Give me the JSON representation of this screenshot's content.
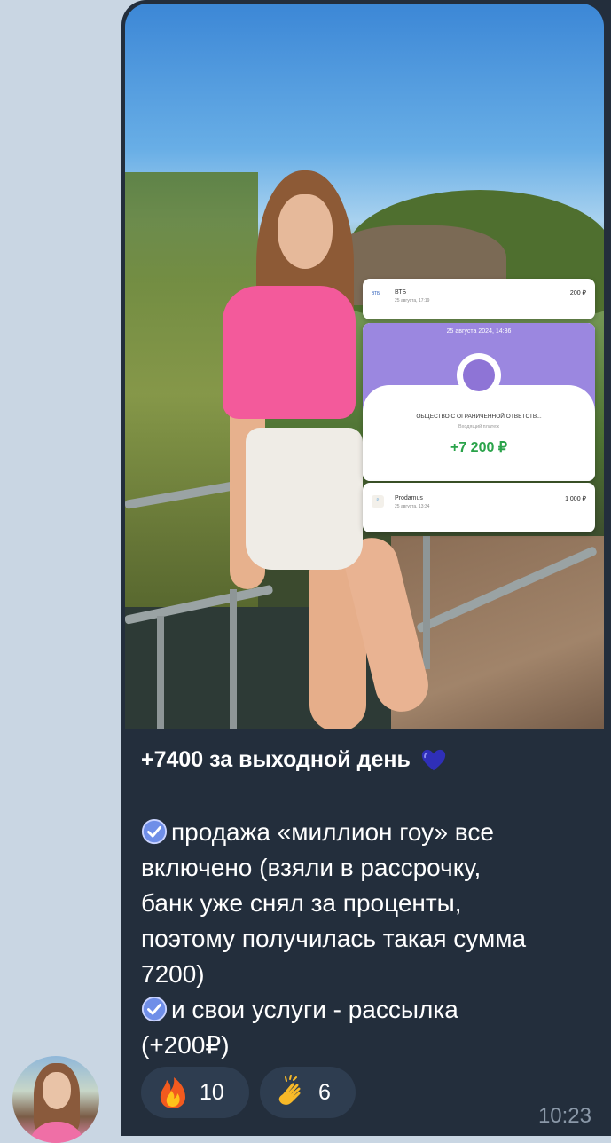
{
  "message": {
    "title": "+7400 за выходной день",
    "body_lines": [
      "продажа «миллион гоу» все",
      "включено (взяли в рассрочку,",
      "банк уже снял за проценты,",
      "поэтому получилась такая сумма",
      "7200)",
      "и свои услуги - рассылка",
      "(+200₽)"
    ],
    "time": "10:23"
  },
  "payments": {
    "vtb": {
      "logo": "ВТБ",
      "name": "ВТБ",
      "date": "25 августа, 17:19",
      "amount": "200 ₽"
    },
    "main": {
      "date": "25 августа 2024, 14:36",
      "org": "ОБЩЕСТВО С ОГРАНИЧЕННОЙ ОТВЕТСТВ...",
      "kind": "Входящий платеж",
      "amount": "+7 200 ₽"
    },
    "prodamus": {
      "logo": "ᴾ",
      "name": "Prodamus",
      "date": "25 августа, 13:34",
      "amount": "1 000 ₽"
    }
  },
  "reactions": [
    {
      "icon": "fire-icon",
      "count": "10"
    },
    {
      "icon": "clap-icon",
      "count": "6"
    }
  ],
  "colors": {
    "background": "#c9d6e3",
    "bubble": "#232e3c",
    "reaction_bg": "#2e3d50",
    "amount_green": "#2aa34a",
    "payment_header": "#9b87e0",
    "check_icon": "#6f8ee8"
  }
}
